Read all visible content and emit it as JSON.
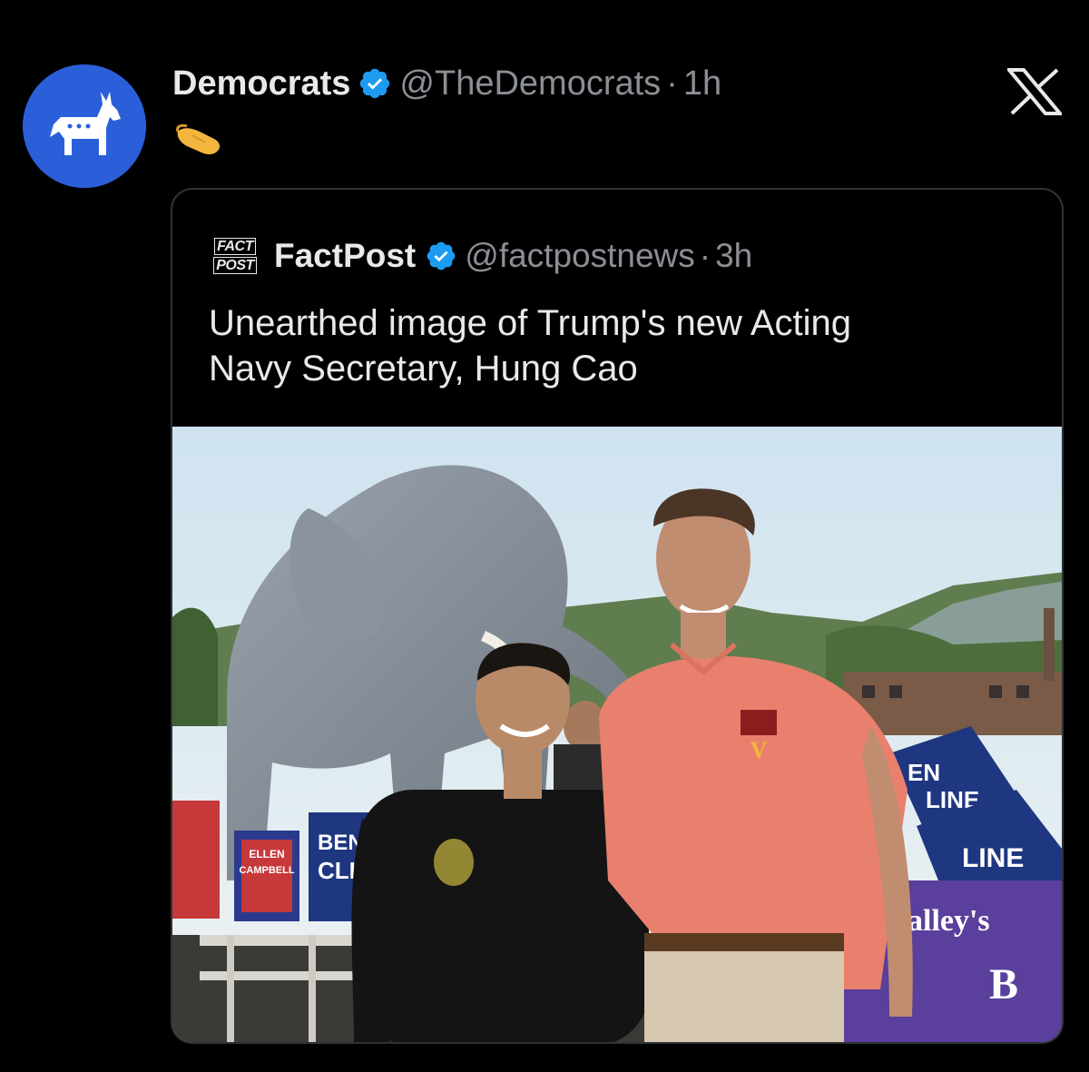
{
  "tweet": {
    "author_name": "Democrats",
    "handle": "@TheDemocrats",
    "separator": "·",
    "time": "1h",
    "emoji_icon": "pinched-hand-emoji",
    "avatar_icon": "democratic-donkey-logo",
    "avatar_color": "#2b5fd9"
  },
  "app": {
    "logo_icon": "x-logo"
  },
  "quoted": {
    "author_name": "FactPost",
    "logo_text_top": "FACT",
    "logo_text_bottom": "POST",
    "handle": "@factpostnews",
    "separator": "·",
    "time": "3h",
    "text_line1": "Unearthed image of Trump's new Acting",
    "text_line2": "Navy Secretary, Hung Cao"
  },
  "photo": {
    "sign1_line1": "BEN",
    "sign1_line2": "CLIN",
    "sign2_line1": "ELLEN",
    "sign2_line2": "CAMPBELL",
    "sign3_line1": "EN",
    "sign3_line2": "LINE",
    "sign4": "LINE",
    "banner1": "alley's",
    "banner2": "B",
    "logo": "V"
  },
  "colors": {
    "verified": "#1d9bf0",
    "background": "#000000",
    "border": "#2f3336"
  }
}
